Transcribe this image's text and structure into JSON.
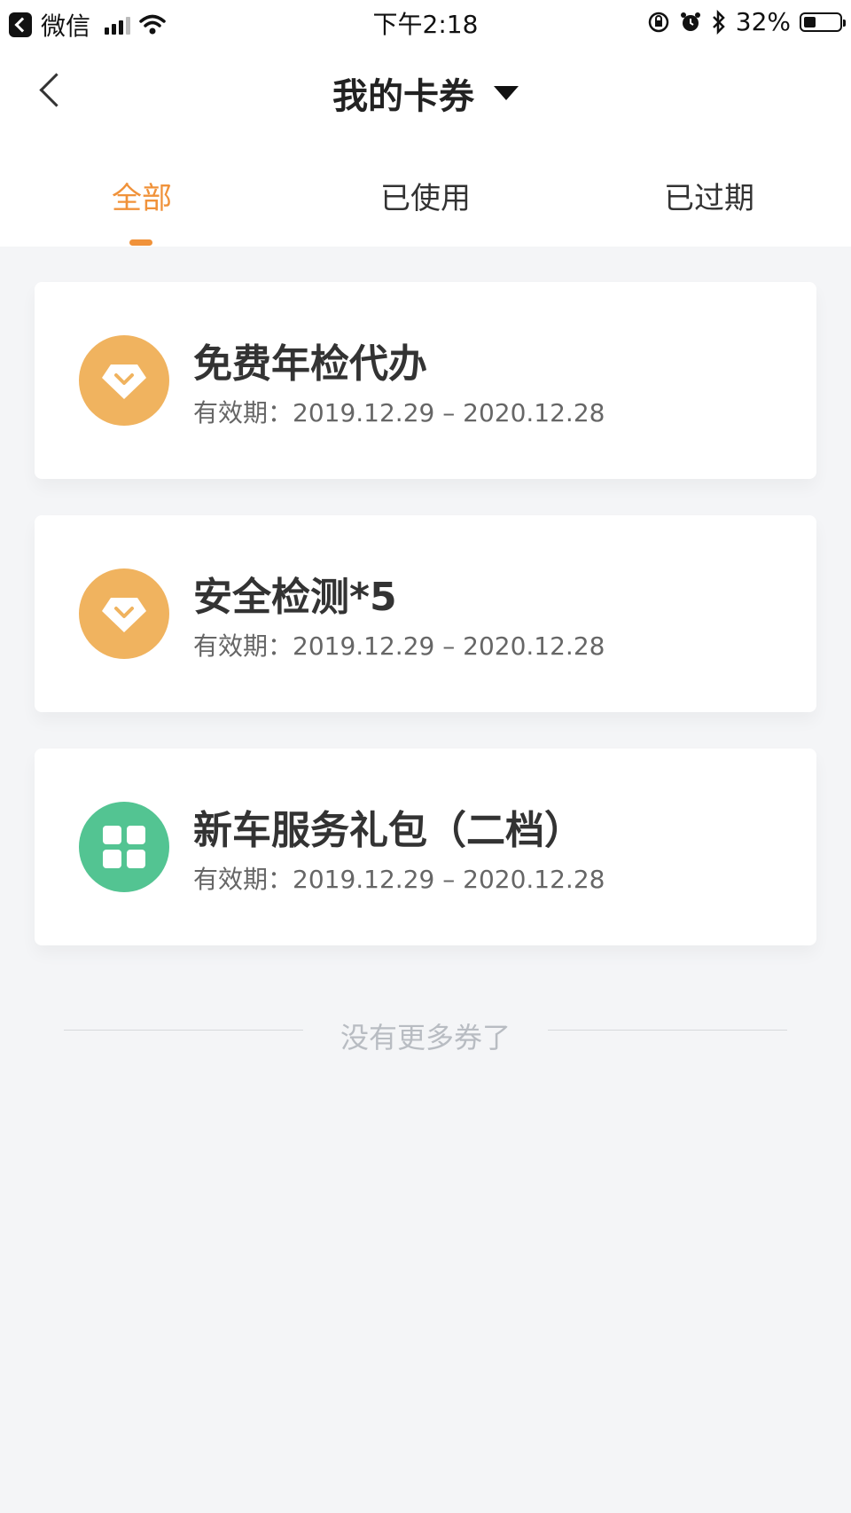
{
  "status_bar": {
    "app_name": "微信",
    "time": "下午2:18",
    "battery_percent": "32%",
    "battery_level": 0.32
  },
  "nav": {
    "title": "我的卡券"
  },
  "tabs": [
    {
      "label": "全部",
      "active": true
    },
    {
      "label": "已使用",
      "active": false
    },
    {
      "label": "已过期",
      "active": false
    }
  ],
  "coupons": [
    {
      "title": "免费年检代办",
      "validity_label": "有效期：",
      "validity_range": "2019.12.29 – 2020.12.28",
      "icon": "diamond-icon",
      "icon_color": "#f0b35f"
    },
    {
      "title": "安全检测*5",
      "validity_label": "有效期：",
      "validity_range": "2019.12.29 – 2020.12.28",
      "icon": "diamond-icon",
      "icon_color": "#f0b35f"
    },
    {
      "title": "新车服务礼包（二档）",
      "validity_label": "有效期：",
      "validity_range": "2019.12.29 – 2020.12.28",
      "icon": "grid-icon",
      "icon_color": "#53c492"
    }
  ],
  "footer": {
    "end_text": "没有更多券了"
  },
  "colors": {
    "accent": "#f0923a",
    "background": "#f4f5f7"
  }
}
